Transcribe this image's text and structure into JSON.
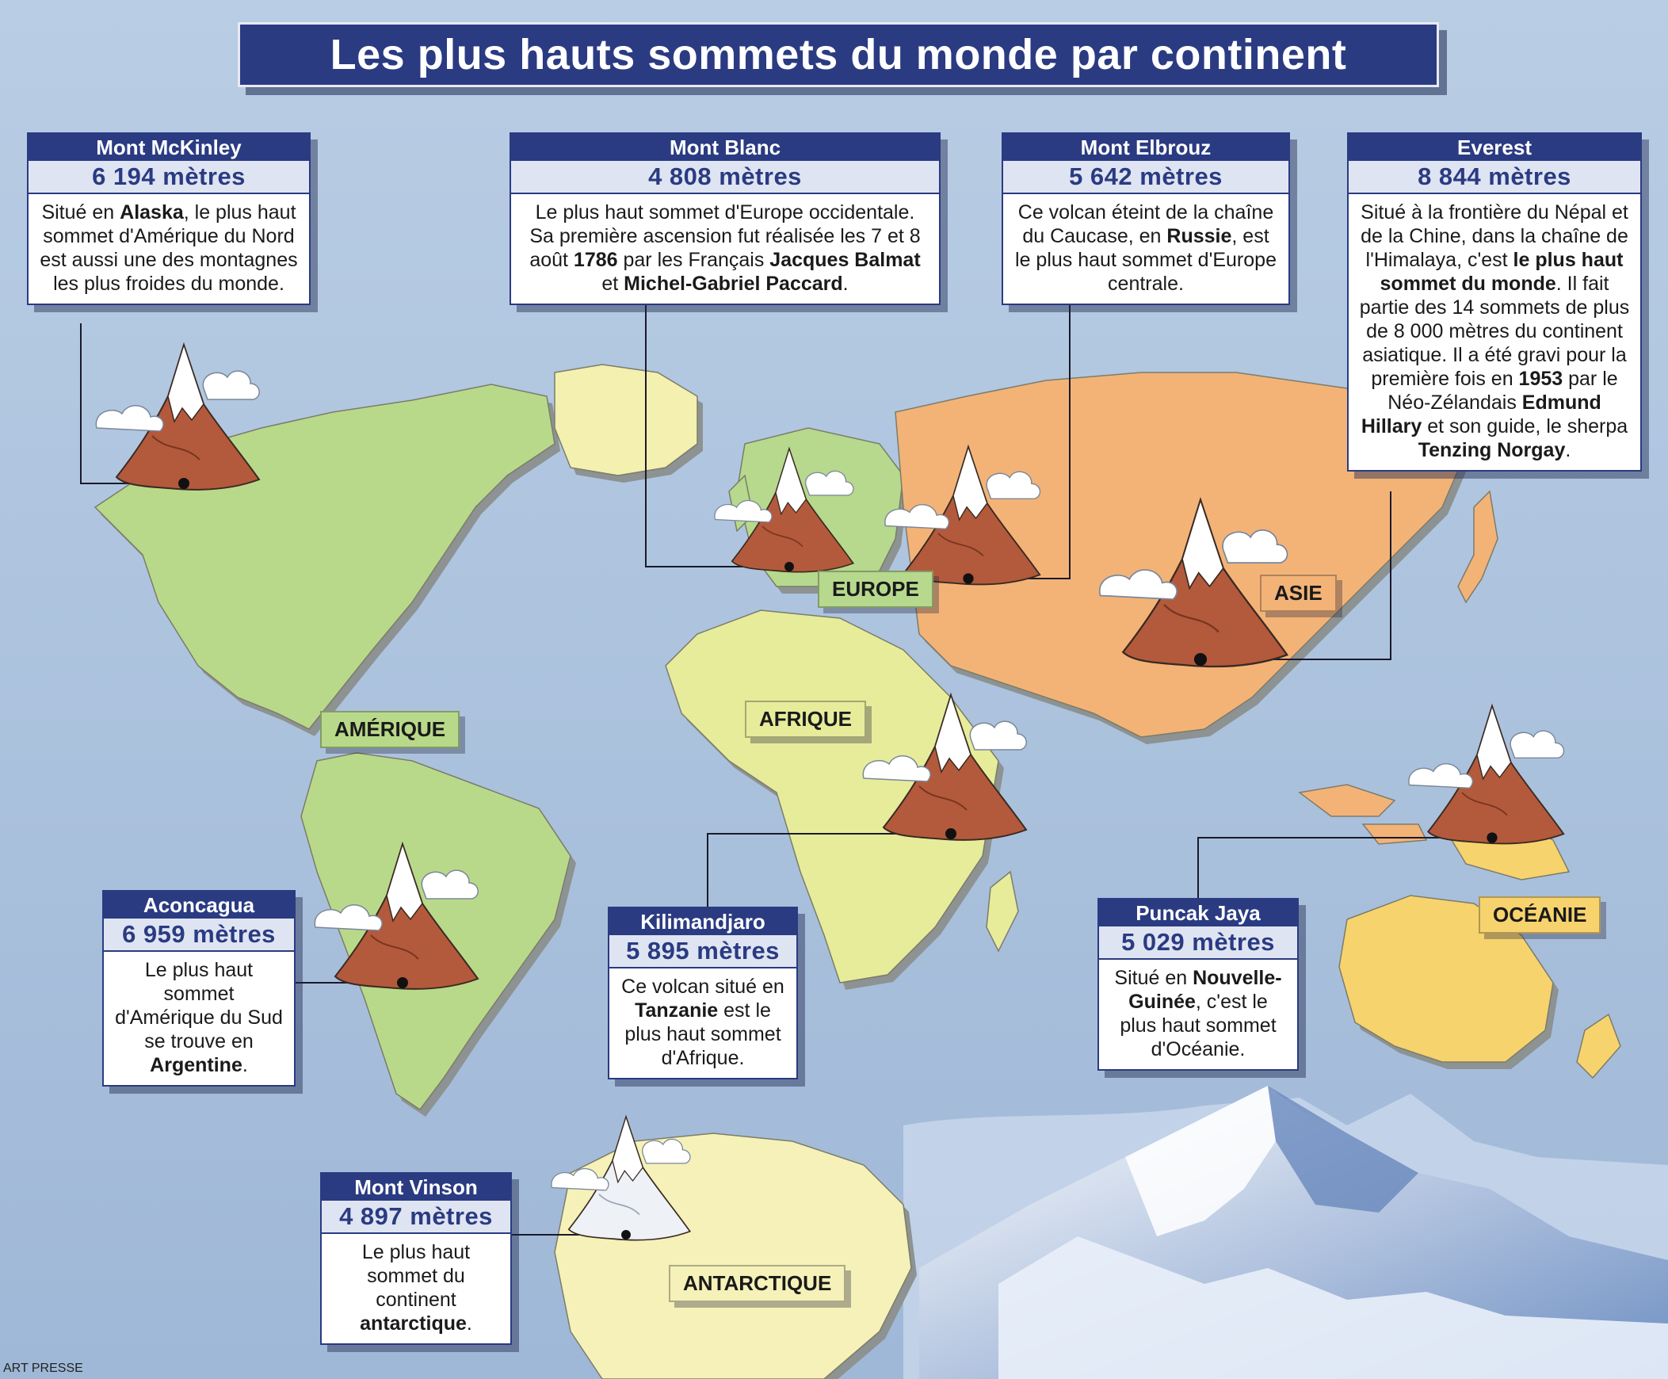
{
  "title": "Les plus hauts sommets du monde par continent",
  "credit": "ART PRESSE",
  "colors": {
    "ocean": "#a9c1dd",
    "america": "#b9d98a",
    "europe": "#b6d98d",
    "africa": "#e6ec9a",
    "asia": "#f3b377",
    "oceania": "#f7d36e",
    "antarctica": "#f5f1b8",
    "navy": "#2a3b82"
  },
  "continents": {
    "amerique": "AMÉRIQUE",
    "europe": "EUROPE",
    "afrique": "AFRIQUE",
    "asie": "ASIE",
    "oceanie": "OCÉANIE",
    "antarctique": "ANTARCTIQUE"
  },
  "peaks": {
    "mckinley": {
      "name": "Mont McKinley",
      "altitude": "6 194 mètres",
      "text": [
        "Situé en ",
        "Alaska",
        ", le plus haut sommet d'Amérique du Nord est aussi une des montagnes les plus froides du monde."
      ]
    },
    "blanc": {
      "name": "Mont Blanc",
      "altitude": "4 808 mètres",
      "text": [
        "Le plus haut sommet d'Europe occidentale. Sa première ascension fut réalisée les 7 et 8 août ",
        "1786",
        " par les Français ",
        "Jacques Balmat",
        " et ",
        "Michel-Gabriel Paccard",
        "."
      ]
    },
    "elbrouz": {
      "name": "Mont Elbrouz",
      "altitude": "5 642 mètres",
      "text": [
        "Ce volcan éteint de la chaîne du Caucase, en ",
        "Russie",
        ", est le plus haut sommet d'Europe centrale."
      ]
    },
    "everest": {
      "name": "Everest",
      "altitude": "8 844 mètres",
      "text": [
        "Situé à la frontière du Népal et de la Chine, dans la chaîne de l'Himalaya, c'est ",
        "le plus haut sommet du monde",
        ". Il fait partie des 14 sommets de plus de 8 000 mètres du continent asiatique. Il a été gravi pour la première fois en ",
        "1953",
        " par le Néo-Zélandais ",
        "Edmund Hillary",
        " et son guide, le sherpa ",
        "Tenzing Norgay",
        "."
      ]
    },
    "aconcagua": {
      "name": "Aconcagua",
      "altitude": "6 959 mètres",
      "text": [
        "Le plus haut sommet d'Amérique du Sud se trouve en ",
        "Argentine",
        "."
      ]
    },
    "kilimandjaro": {
      "name": "Kilimandjaro",
      "altitude": "5 895 mètres",
      "text": [
        "Ce volcan situé en ",
        "Tanzanie",
        " est le plus haut sommet d'Afrique."
      ]
    },
    "puncak": {
      "name": "Puncak Jaya",
      "altitude": "5 029 mètres",
      "text": [
        "Situé en ",
        "Nouvelle-Guinée",
        ", c'est le plus haut sommet d'Océanie."
      ]
    },
    "vinson": {
      "name": "Mont Vinson",
      "altitude": "4 897 mètres",
      "text": [
        "Le plus haut sommet du continent ",
        "antarctique",
        "."
      ]
    }
  }
}
